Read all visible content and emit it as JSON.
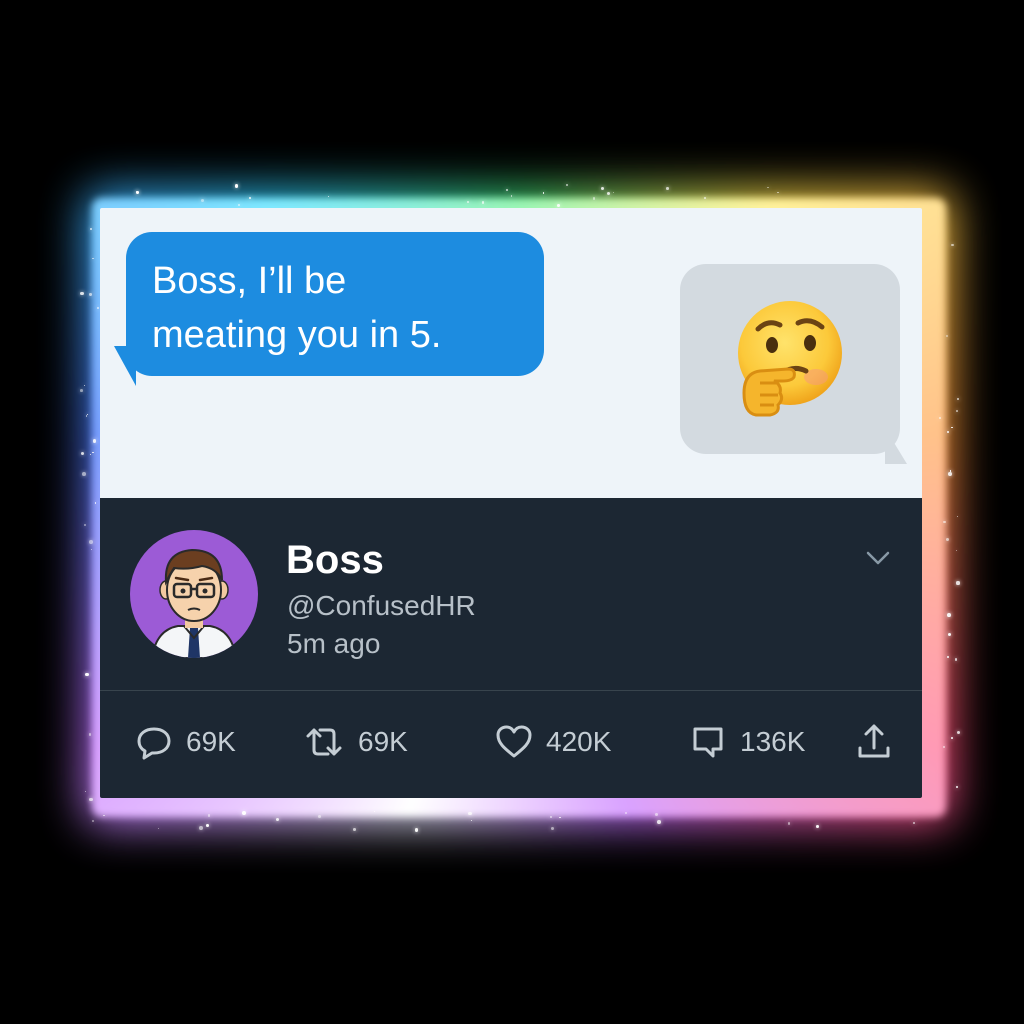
{
  "chat": {
    "message_line1": "Boss, I’ll be",
    "message_line2": "meating you in 5.",
    "reply_emoji": "thinking-face"
  },
  "tweet": {
    "name": "Boss",
    "handle": "@ConfusedHR",
    "time": "5m ago",
    "actions": {
      "replies": "69K",
      "retweets": "69K",
      "likes": "420K",
      "quotes": "136K"
    }
  },
  "colors": {
    "message_bubble": "#1d8ce0",
    "reply_bubble": "#d3dae0",
    "tweet_background": "#1c2733",
    "avatar_background": "#9c5bd6"
  }
}
